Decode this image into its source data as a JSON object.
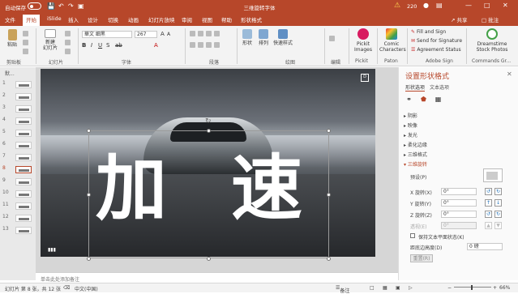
{
  "titlebar": {
    "autosave": "自动保存",
    "autosave_state": "关",
    "doc_title": "三维旋转字体",
    "warning_count": "220",
    "icons": [
      "save-icon",
      "undo-icon",
      "redo-icon",
      "present-icon",
      "minimize-icon",
      "maximize-icon",
      "close-icon"
    ]
  },
  "tabs": [
    "文件",
    "开始",
    "iSlide",
    "插入",
    "设计",
    "切换",
    "动画",
    "幻灯片放映",
    "审阅",
    "视图",
    "帮助",
    "形状格式"
  ],
  "active_tab": "开始",
  "share_label": "共享",
  "comment_label": "批注",
  "ribbon": {
    "paste": "粘贴",
    "new_slide": "新建\n幻灯片",
    "font_name": "華文 细黑",
    "font_size": "267",
    "shapes": "形状",
    "arrange": "排列",
    "quick_styles": "快速样式",
    "pickit": "Pickit\nImages",
    "comic": "Comic\nCharacters",
    "fill_sign": "Fill and Sign",
    "send_sign": "Send for Signature",
    "agreement": "Agreement Status",
    "dreamstime": "Dreamstime\nStock Photos",
    "groups": [
      "剪贴板",
      "幻灯片",
      "字体",
      "段落",
      "绘图",
      "编辑",
      "Pickit",
      "Paton",
      "Adobe Sign",
      "Commands Gr..."
    ]
  },
  "thumbnails": {
    "header": "默...",
    "numbers": [
      "1",
      "2",
      "3",
      "4",
      "5",
      "6",
      "7",
      "8",
      "9",
      "10",
      "11",
      "12",
      "13"
    ],
    "selected": "8"
  },
  "slide": {
    "char1": "加",
    "char2": "速",
    "logo": "D"
  },
  "notes_placeholder": "单击此处添加备注",
  "pane": {
    "title": "设置形状格式",
    "tab_shape": "形状选项",
    "tab_text": "文本选项",
    "sections": [
      "阴影",
      "映像",
      "发光",
      "柔化边缘",
      "三维格式",
      "三维旋转"
    ],
    "preset_label": "预设(P)",
    "x_label": "X 旋转(X)",
    "y_label": "Y 旋转(Y)",
    "z_label": "Z 旋转(Z)",
    "perspective_label": "透视(E)",
    "x_value": "0°",
    "y_value": "0°",
    "z_value": "0°",
    "perspective_value": "0°",
    "keep_text_flat": "保持文本平面状态(K)",
    "distance_label": "距底边高度(D)",
    "distance_value": "0 磅",
    "reset_label": "重置(R)"
  },
  "statusbar": {
    "slide_info": "幻灯片 第 8 张，共 12 张",
    "language": "中文(中国)",
    "notes_btn": "备注",
    "zoom": "66%"
  }
}
